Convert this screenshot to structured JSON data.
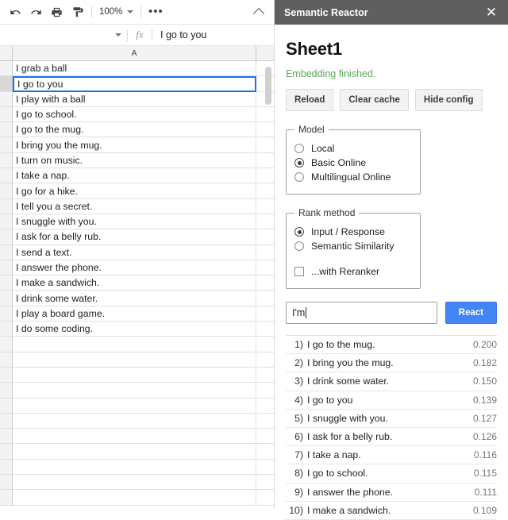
{
  "sheets": {
    "toolbar": {
      "undo_icon": "undo-icon",
      "redo_icon": "redo-icon",
      "print_icon": "print-icon",
      "paint_format_icon": "paint-format-icon",
      "zoom_value": "100%",
      "more_label": "•••"
    },
    "formula_bar": {
      "name_box_value": "",
      "fx_label": "fx",
      "content": "I go to you"
    },
    "column_header": "A",
    "selected_row_index": 1,
    "cells": [
      "I grab a ball",
      "I go to you",
      "I play with a ball",
      "I go to school.",
      "I go to the mug.",
      "I bring you the mug.",
      "I turn on music.",
      "I take a nap.",
      "I go for a hike.",
      "I tell you a secret.",
      "I snuggle with you.",
      "I ask for a belly rub.",
      "I send a text.",
      "I answer the phone.",
      "I make a sandwich.",
      "I drink some water.",
      "I play a board game.",
      "I do some coding.",
      "",
      "",
      "",
      "",
      "",
      "",
      "",
      "",
      "",
      "",
      ""
    ]
  },
  "panel": {
    "title": "Semantic Reactor",
    "close_label": "✕",
    "sheet_name": "Sheet1",
    "status": "Embedding finished.",
    "buttons": {
      "reload": "Reload",
      "clear_cache": "Clear cache",
      "hide_config": "Hide config"
    },
    "model": {
      "legend": "Model",
      "options": [
        {
          "label": "Local",
          "selected": false
        },
        {
          "label": "Basic Online",
          "selected": true
        },
        {
          "label": "Multilingual Online",
          "selected": false
        }
      ]
    },
    "rank_method": {
      "legend": "Rank method",
      "options": [
        {
          "label": "Input / Response",
          "selected": true
        },
        {
          "label": "Semantic Similarity",
          "selected": false
        }
      ],
      "reranker": {
        "label": "...with Reranker",
        "checked": false
      }
    },
    "query": {
      "value": "I'm ",
      "placeholder": "",
      "react_label": "React"
    },
    "results": [
      {
        "rank": "1)",
        "text": "I go to the mug.",
        "score": "0.200"
      },
      {
        "rank": "2)",
        "text": "I bring you the mug.",
        "score": "0.182"
      },
      {
        "rank": "3)",
        "text": "I drink some water.",
        "score": "0.150"
      },
      {
        "rank": "4)",
        "text": "I go to you",
        "score": "0.139"
      },
      {
        "rank": "5)",
        "text": "I snuggle with you.",
        "score": "0.127"
      },
      {
        "rank": "6)",
        "text": "I ask for a belly rub.",
        "score": "0.126"
      },
      {
        "rank": "7)",
        "text": "I take a nap.",
        "score": "0.116"
      },
      {
        "rank": "8)",
        "text": "I go to school.",
        "score": "0.115"
      },
      {
        "rank": "9)",
        "text": "I answer the phone.",
        "score": "0.111"
      },
      {
        "rank": "10)",
        "text": "I make a sandwich.",
        "score": "0.109"
      }
    ]
  },
  "colors": {
    "panel_header_bg": "#5f5f5f",
    "status_green": "#5aa85a",
    "accent_blue": "#4285f4",
    "selection_blue": "#1a73e8"
  }
}
